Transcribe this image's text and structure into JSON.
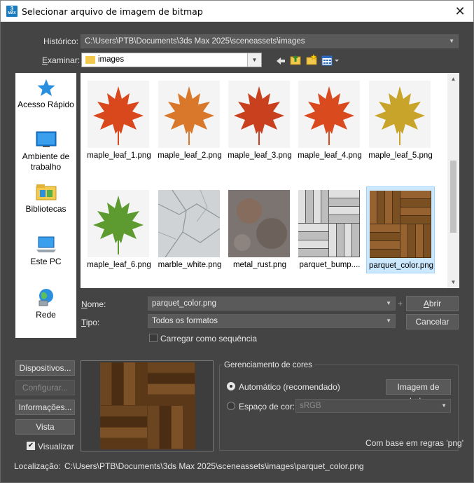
{
  "window": {
    "title": "Selecionar arquivo de imagem de bitmap",
    "app_badge": "3",
    "app_badge_sub": "MAX"
  },
  "history": {
    "label": "Histórico:",
    "value": "C:\\Users\\PTB\\Documents\\3ds Max 2025\\sceneassets\\images"
  },
  "look_in": {
    "label_prefix": "E",
    "label_rest": "xaminar:",
    "value": "images"
  },
  "places": [
    {
      "label": "Acesso Rápido",
      "icon": "star-icon"
    },
    {
      "label": "Ambiente de trabalho",
      "icon": "desktop-icon"
    },
    {
      "label": "Bibliotecas",
      "icon": "libraries-icon"
    },
    {
      "label": "Este PC",
      "icon": "computer-icon"
    },
    {
      "label": "Rede",
      "icon": "network-icon"
    }
  ],
  "files": [
    {
      "name": "maple_leaf_1.png",
      "kind": "leaf",
      "color": "#d9471c"
    },
    {
      "name": "maple_leaf_2.png",
      "kind": "leaf",
      "color": "#d9782a"
    },
    {
      "name": "maple_leaf_3.png",
      "kind": "leaf",
      "color": "#c8401d"
    },
    {
      "name": "maple_leaf_4.png",
      "kind": "leaf",
      "color": "#d94a1e"
    },
    {
      "name": "maple_leaf_5.png",
      "kind": "leaf",
      "color": "#c9a42a"
    },
    {
      "name": "maple_leaf_6.png",
      "kind": "leaf",
      "color": "#5d9a2f"
    },
    {
      "name": "marble_white.png",
      "kind": "marble",
      "color": "#c9cdd0"
    },
    {
      "name": "metal_rust.png",
      "kind": "rust",
      "color": "#7b7470"
    },
    {
      "name": "parquet_bump....",
      "kind": "parquet-bw",
      "color": "#8a8a8a"
    },
    {
      "name": "parquet_color.png",
      "kind": "parquet",
      "color": "#6b4520",
      "selected": true
    }
  ],
  "name_field": {
    "label_prefix": "N",
    "label_rest": "ome:",
    "value": "parquet_color.png"
  },
  "type_field": {
    "label_prefix": "T",
    "label_rest": "ipo:",
    "value": "Todos os formatos"
  },
  "open_button": "Abrir",
  "cancel_button": "Cancelar",
  "sequence_checkbox": {
    "label": "Carregar como sequência",
    "checked": false
  },
  "side_buttons": {
    "devices": "Dispositivos...",
    "setup": "Configurar...",
    "info": "Informações...",
    "view": "Vista"
  },
  "preview_checkbox": {
    "label": "Visualizar",
    "checked": true
  },
  "color_mgmt": {
    "title": "Gerenciamento de cores",
    "auto_label": "Automático (recomendado)",
    "data_image_button": "Imagem de dados",
    "space_label": "Espaço de cor:",
    "space_value": "sRGB",
    "rule_note": "Com base em regras 'png'"
  },
  "location": {
    "label": "Localização:",
    "value": "C:\\Users\\PTB\\Documents\\3ds Max 2025\\sceneassets\\images\\parquet_color.png"
  }
}
